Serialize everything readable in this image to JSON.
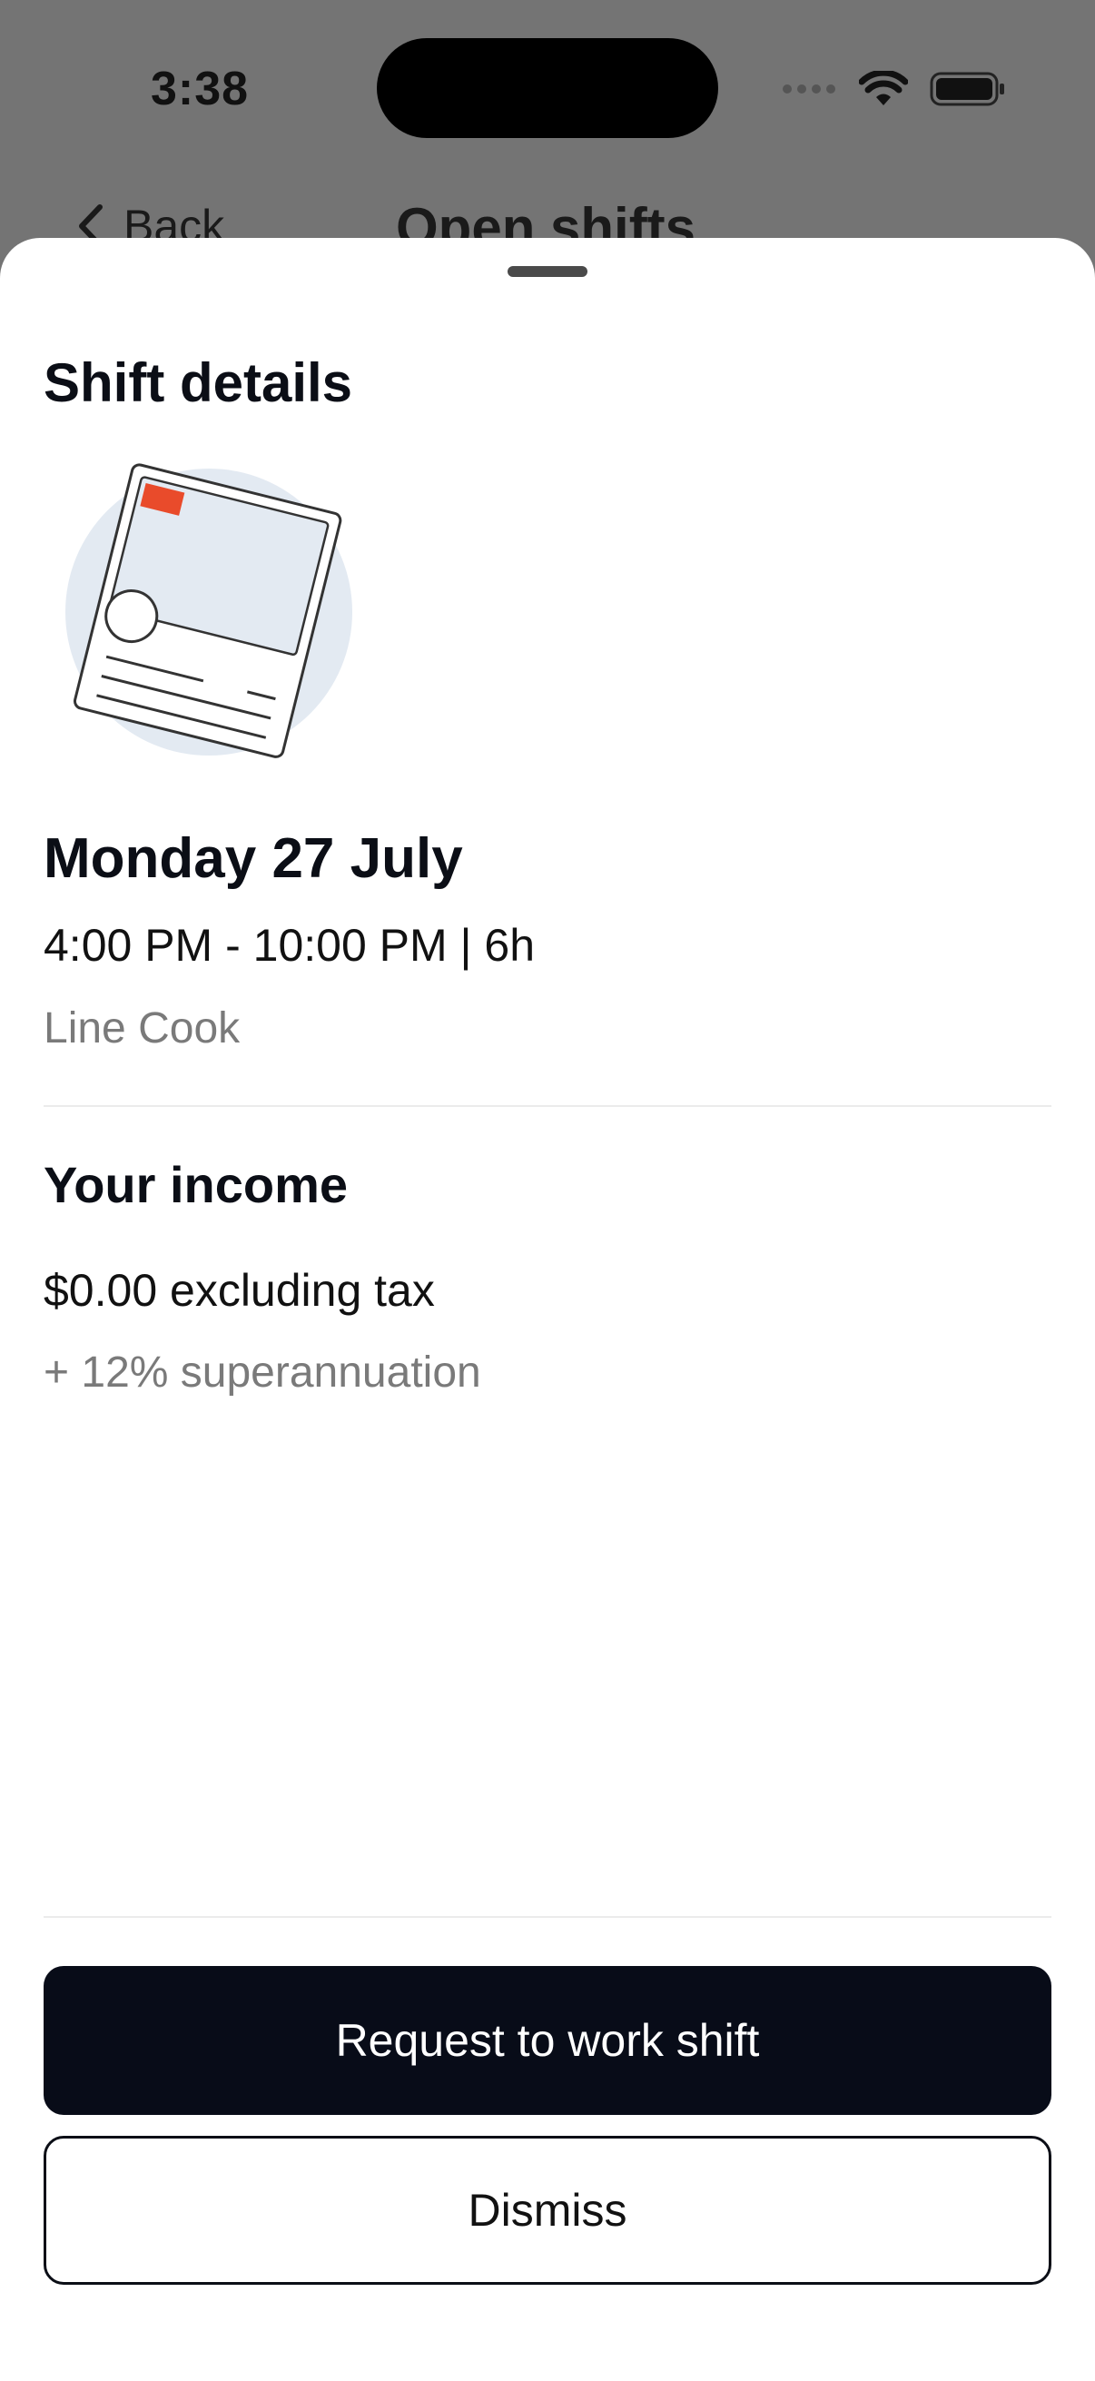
{
  "status_bar": {
    "time": "3:38"
  },
  "background_nav": {
    "back_label": "Back",
    "title": "Open shifts"
  },
  "sheet": {
    "title": "Shift details",
    "shift": {
      "date": "Monday 27 July",
      "time_range": "4:00 PM - 10:00 PM | 6h",
      "role": "Line Cook"
    },
    "income": {
      "title": "Your income",
      "amount": "$0.00 excluding tax",
      "superannuation": "+ 12% superannuation"
    },
    "buttons": {
      "primary": "Request to work shift",
      "secondary": "Dismiss"
    }
  },
  "colors": {
    "accent": "#E94B2B",
    "primary_button": "#080C18",
    "illustration_bg": "#E3EAF2"
  }
}
